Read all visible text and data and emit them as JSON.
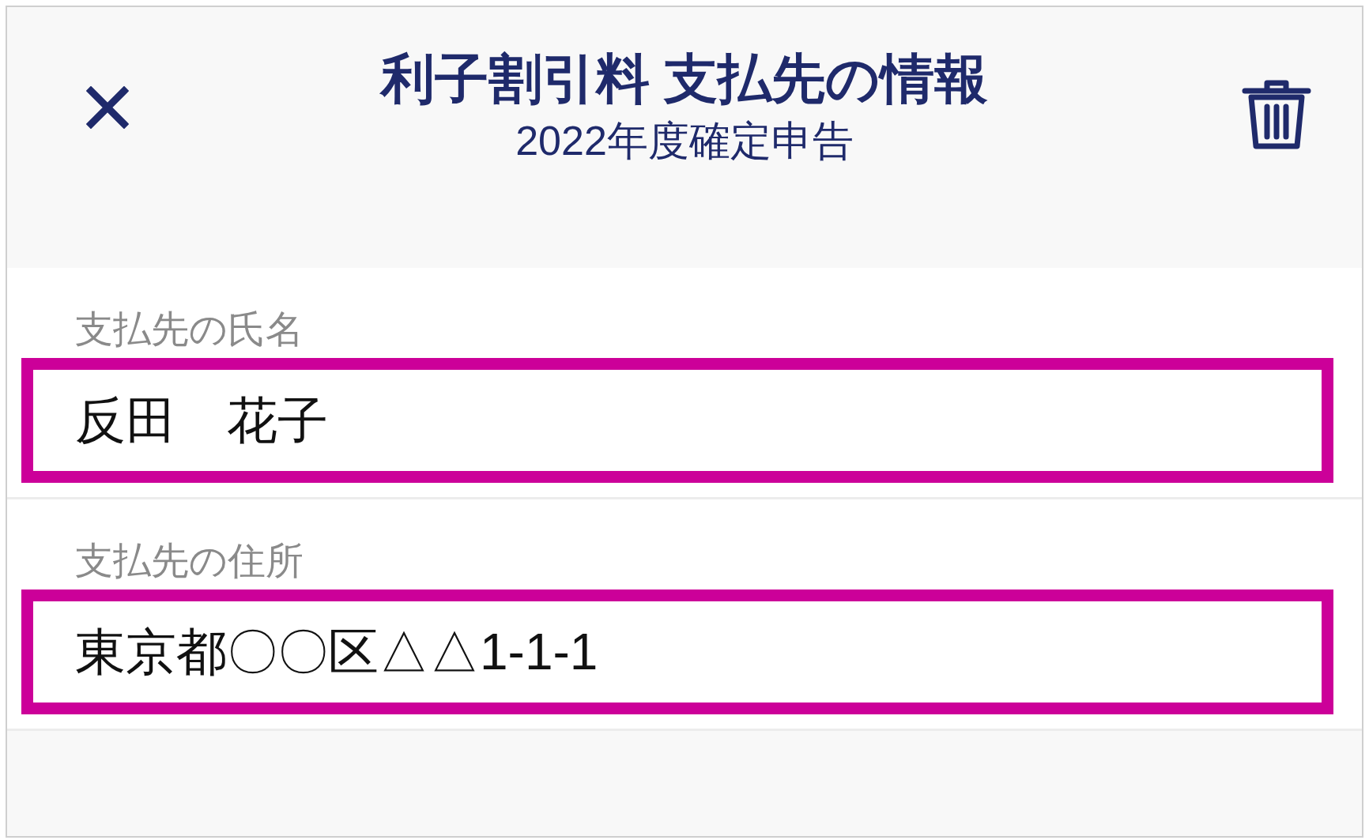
{
  "header": {
    "title": "利子割引料 支払先の情報",
    "subtitle": "2022年度確定申告"
  },
  "fields": [
    {
      "label": "支払先の氏名",
      "value": "反田　花子"
    },
    {
      "label": "支払先の住所",
      "value": "東京都〇〇区△△1-1-1"
    }
  ]
}
